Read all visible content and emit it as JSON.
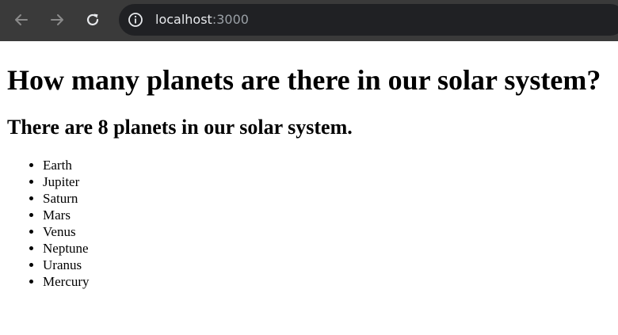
{
  "browser": {
    "url_host": "localhost",
    "url_port": ":3000",
    "icons": {
      "back": "arrow-left-icon",
      "forward": "arrow-right-icon",
      "reload": "reload-icon",
      "site_info": "info-icon"
    },
    "colors": {
      "toolbar": "#3a3a3a",
      "omnibox": "#202124",
      "url_host": "#e8eaed",
      "url_port": "#9aa0a6"
    }
  },
  "page": {
    "heading": "How many planets are there in our solar system?",
    "subheading": "There are 8 planets in our solar system.",
    "planets": [
      "Earth",
      "Jupiter",
      "Saturn",
      "Mars",
      "Venus",
      "Neptune",
      "Uranus",
      "Mercury"
    ]
  }
}
